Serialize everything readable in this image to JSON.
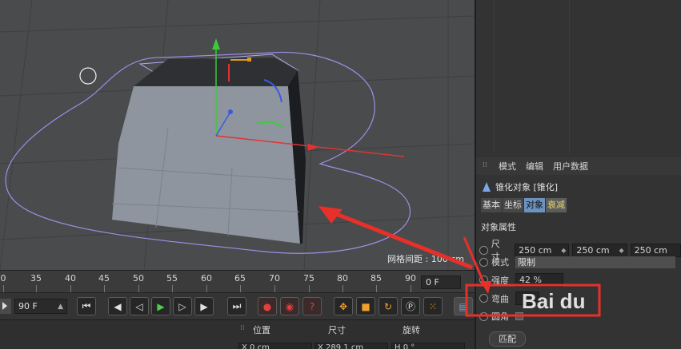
{
  "viewport": {
    "grid_label": "网格间距 : 100 cm"
  },
  "timeline": {
    "ticks": [
      "0",
      "35",
      "40",
      "45",
      "50",
      "55",
      "60",
      "65",
      "70",
      "75",
      "80",
      "85",
      "90"
    ],
    "current_frame": "0 F"
  },
  "transport": {
    "end_frame": "90 F",
    "icons": [
      "first-frame-icon",
      "prev-key-icon",
      "prev-frame-icon",
      "play-icon",
      "next-frame-icon",
      "next-key-icon",
      "last-frame-icon",
      "record-icon",
      "autokey-icon",
      "keyframe-selection-icon",
      "move-key-icon",
      "scale-key-icon",
      "rotate-key-icon",
      "param-key-icon",
      "pla-key-icon",
      "timeline-icon"
    ]
  },
  "coords": {
    "headers": [
      "位置",
      "尺寸",
      "旋转"
    ],
    "x_pos": "X  0 cm",
    "x_size": "X  289.1 cm",
    "h_rot": "H  0 °"
  },
  "attributes": {
    "menu": [
      "模式",
      "编辑",
      "用户数据"
    ],
    "object_title": "锥化对象 [锥化]",
    "tabs": [
      "基本",
      "坐标",
      "对象",
      "衰减"
    ],
    "section": "对象属性",
    "size_label": "尺寸",
    "size_values": [
      "250 cm",
      "250 cm",
      "250 cm"
    ],
    "mode_label": "模式",
    "mode_value": "限制",
    "strength_label": "强度",
    "strength_value": "42 %",
    "bend_label": "弯曲",
    "fillet_label": "圆角",
    "bottom_button": "匹配"
  },
  "watermark": "Bai du"
}
